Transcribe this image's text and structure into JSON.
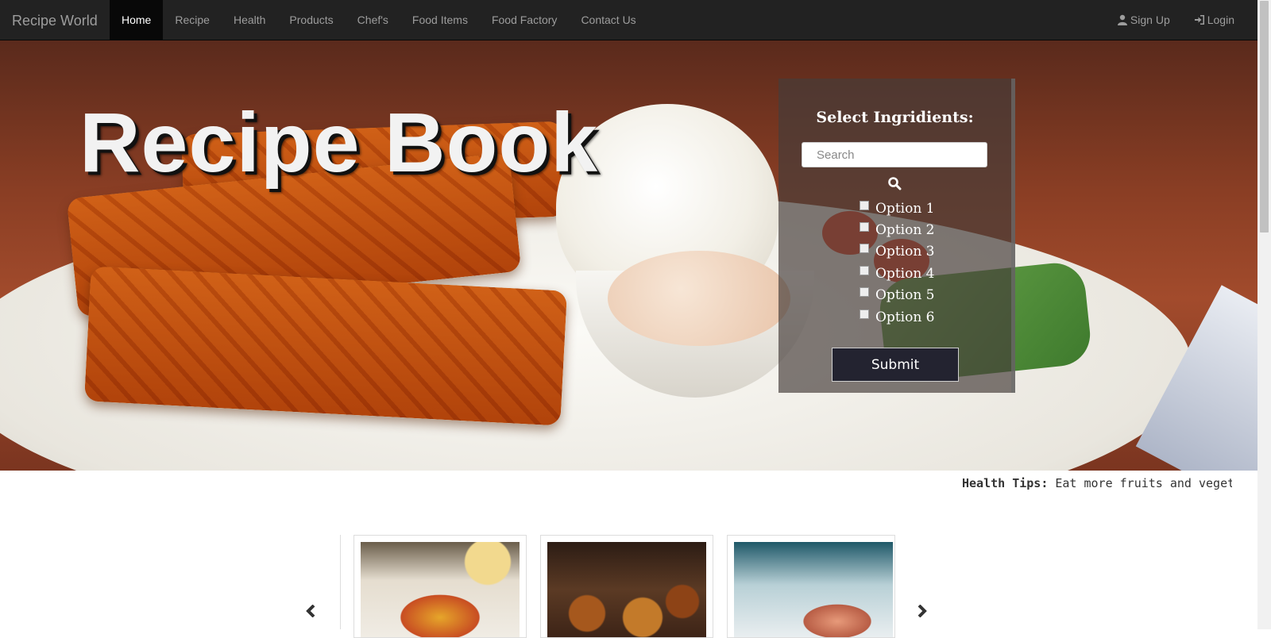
{
  "navbar": {
    "brand": "Recipe World",
    "links": [
      {
        "label": "Home",
        "active": true
      },
      {
        "label": "Recipe"
      },
      {
        "label": "Health"
      },
      {
        "label": "Products"
      },
      {
        "label": "Chef's"
      },
      {
        "label": "Food Items"
      },
      {
        "label": "Food Factory"
      },
      {
        "label": "Contact Us"
      }
    ],
    "right": {
      "signup": {
        "label": "Sign Up",
        "icon": "user-icon"
      },
      "login": {
        "label": "Login",
        "icon": "login-icon"
      }
    }
  },
  "hero": {
    "title": "Recipe Book",
    "panel": {
      "title": "Select Ingridients:",
      "search_placeholder": "Search",
      "search_icon": "search-icon",
      "options": [
        "Option 1",
        "Option 2",
        "Option 3",
        "Option 4",
        "Option 5",
        "Option 6"
      ],
      "submit_label": "Submit"
    }
  },
  "health_tips": {
    "label": "Health Tips:",
    "text": "Eat more fruits and vegetables"
  },
  "carousel": {
    "prev_icon": "chevron-left-icon",
    "next_icon": "chevron-right-icon"
  },
  "colors": {
    "navbar_bg": "#222222",
    "nav_active_bg": "#080808",
    "nav_text": "#9d9d9d",
    "submit_bg": "#232330"
  }
}
